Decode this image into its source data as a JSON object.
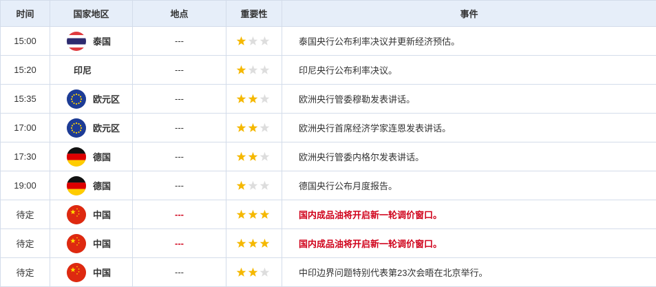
{
  "header": {
    "time": "时间",
    "country": "国家地区",
    "place": "地点",
    "importance": "重要性",
    "event": "事件"
  },
  "colors": {
    "star_on": "#f5b800",
    "star_off": "#dddddd",
    "highlight_text": "#d0021b",
    "header_bg": "#e6eef9",
    "grid": "#d3dcea"
  },
  "rows": [
    {
      "time": "15:00",
      "country": "泰国",
      "flag": "thailand-flag-icon",
      "place": "---",
      "stars": 1,
      "event": "泰国央行公布利率决议并更新经济预估。",
      "highlight": false
    },
    {
      "time": "15:20",
      "country": "印尼",
      "flag": "",
      "place": "---",
      "stars": 1,
      "event": "印尼央行公布利率决议。",
      "highlight": false
    },
    {
      "time": "15:35",
      "country": "欧元区",
      "flag": "eu-flag-icon",
      "place": "---",
      "stars": 2,
      "event": "欧洲央行管委穆勒发表讲话。",
      "highlight": false
    },
    {
      "time": "17:00",
      "country": "欧元区",
      "flag": "eu-flag-icon",
      "place": "---",
      "stars": 2,
      "event": "欧洲央行首席经济学家连恩发表讲话。",
      "highlight": false
    },
    {
      "time": "17:30",
      "country": "德国",
      "flag": "germany-flag-icon",
      "place": "---",
      "stars": 2,
      "event": "欧洲央行管委内格尔发表讲话。",
      "highlight": false
    },
    {
      "time": "19:00",
      "country": "德国",
      "flag": "germany-flag-icon",
      "place": "---",
      "stars": 1,
      "event": "德国央行公布月度报告。",
      "highlight": false
    },
    {
      "time": "待定",
      "country": "中国",
      "flag": "china-flag-icon",
      "place": "---",
      "stars": 3,
      "event": "国内成品油将开启新一轮调价窗口。",
      "highlight": true
    },
    {
      "time": "待定",
      "country": "中国",
      "flag": "china-flag-icon",
      "place": "---",
      "stars": 3,
      "event": "国内成品油将开启新一轮调价窗口。",
      "highlight": true
    },
    {
      "time": "待定",
      "country": "中国",
      "flag": "china-flag-icon",
      "place": "---",
      "stars": 2,
      "event": "中印边界问题特别代表第23次会晤在北京举行。",
      "highlight": false
    }
  ]
}
